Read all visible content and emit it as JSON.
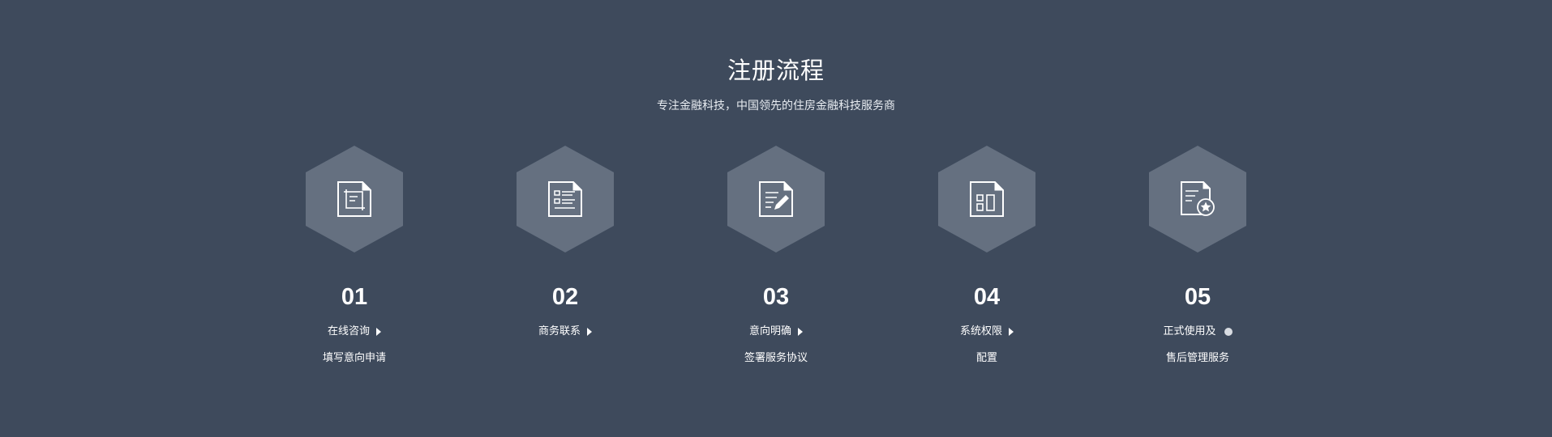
{
  "header": {
    "title": "注册流程",
    "subtitle": "专注金融科技，中国领先的住房金融科技服务商"
  },
  "steps": [
    {
      "number": "01",
      "label": "在线咨询",
      "label2": "填写意向申请",
      "marker": "arrow",
      "icon": "crop-document-icon"
    },
    {
      "number": "02",
      "label": "商务联系",
      "label2": "",
      "marker": "arrow",
      "icon": "list-document-icon"
    },
    {
      "number": "03",
      "label": "意向明确",
      "label2": "签署服务协议",
      "marker": "arrow",
      "icon": "edit-document-icon"
    },
    {
      "number": "04",
      "label": "系统权限",
      "label2": "配置",
      "marker": "arrow",
      "icon": "layout-document-icon"
    },
    {
      "number": "05",
      "label": "正式使用及",
      "label2": "售后管理服务",
      "marker": "dot",
      "icon": "star-document-icon"
    }
  ],
  "colors": {
    "background": "#3e4a5c",
    "hexagon": "#657080",
    "text": "#ffffff"
  }
}
